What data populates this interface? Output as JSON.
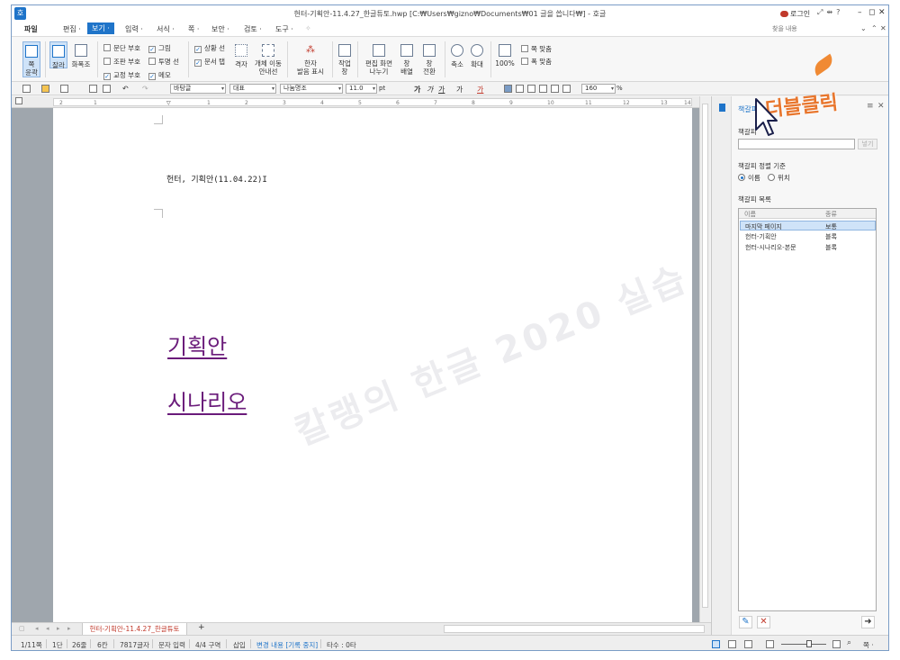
{
  "window": {
    "title": "헌터-기획안-11.4.27_한글튜토.hwp [C:₩Users₩gizno₩Documents₩01 글을 씁니다₩] - 호글",
    "login_label": "로그인",
    "app_logo": "호"
  },
  "menu": {
    "items": [
      "파일",
      "편집 ·",
      "보기 ·",
      "입력 ·",
      "서식 ·",
      "쪽 ·",
      "보안 ·",
      "검토 ·",
      "도구 ·"
    ],
    "active_index": 2,
    "search_placeholder": "찾을 내용"
  },
  "ribbon": {
    "page_outline": "쪽\n윤곽",
    "ruler": "잘라",
    "zoom_view": "화폭조",
    "checks": [
      {
        "label": "문단 부호",
        "checked": false
      },
      {
        "label": "조판 부호",
        "checked": false
      },
      {
        "label": "교정 부호",
        "checked": true
      },
      {
        "label": "그림",
        "checked": true
      },
      {
        "label": "투명 선",
        "checked": false
      },
      {
        "label": "메모",
        "checked": true
      },
      {
        "label": "상황 선",
        "checked": true
      },
      {
        "label": "문서 탭",
        "checked": true
      }
    ],
    "grid": "격자",
    "move_guide": "개체 이동\n안내선",
    "hanja": "한자\n발음 표시",
    "workspace": "작업\n창",
    "split_view": "편집 화면\n나누기",
    "window_arrange": "창\n배열",
    "window_switch": "창\n전환",
    "zoom_out": "축소",
    "zoom_in": "확대",
    "zoom_100": "100%",
    "fit_page": "쪽 맞춤",
    "fit_width": "폭 맞춤"
  },
  "format_bar": {
    "style": "바탕글",
    "language": "대표",
    "font": "나눔명조",
    "size": "11.0",
    "size_unit": "pt",
    "zoom_value": "160",
    "zoom_unit": "%",
    "letter_styles": [
      "가",
      "가",
      "가",
      "가",
      "가"
    ]
  },
  "ruler": {
    "numbers": [
      "2",
      "1",
      "1",
      "2",
      "3",
      "4",
      "5",
      "6",
      "7",
      "8",
      "9",
      "10",
      "11",
      "12",
      "13",
      "14"
    ]
  },
  "document": {
    "header_line": "헌터, 기획안(11.04.22)I",
    "links": [
      "기획안",
      "시나리오"
    ]
  },
  "bookmark_panel": {
    "title": "책갈피",
    "name_label": "책갈피",
    "insert_button": "넣기",
    "sort_label": "책갈피 정렬 기준",
    "sort_options": [
      {
        "label": "이름",
        "selected": true
      },
      {
        "label": "위치",
        "selected": false
      }
    ],
    "list_label": "책갈피 목록",
    "columns": [
      "이름",
      "종류"
    ],
    "rows": [
      {
        "name": "마지막 페이지",
        "type": "보통"
      },
      {
        "name": "헌터-기획안",
        "type": "블록"
      },
      {
        "name": "헌터-시나리오-본문",
        "type": "블록"
      }
    ],
    "selected_row": 0
  },
  "tabs": {
    "document_tab": "헌터-기획안-11.4.27_한글튜토",
    "add_tab": "+"
  },
  "status": {
    "items": [
      "1/11쪽",
      "1단",
      "26줄",
      "6칸",
      "7817글자",
      "문자 입력",
      "4/4 구역",
      "삽입",
      "변경 내용 [기록 중지]",
      "타수 : 0타"
    ],
    "zoom_label": "쪽 ·"
  },
  "overlay": {
    "annotation": "더블클릭",
    "watermark": "칼랭의 한글 2020 실습"
  },
  "colors": {
    "accent": "#1f74c9",
    "link": "#6a1b7a",
    "annotation": "#e8762d",
    "tab_text": "#c0392b"
  }
}
